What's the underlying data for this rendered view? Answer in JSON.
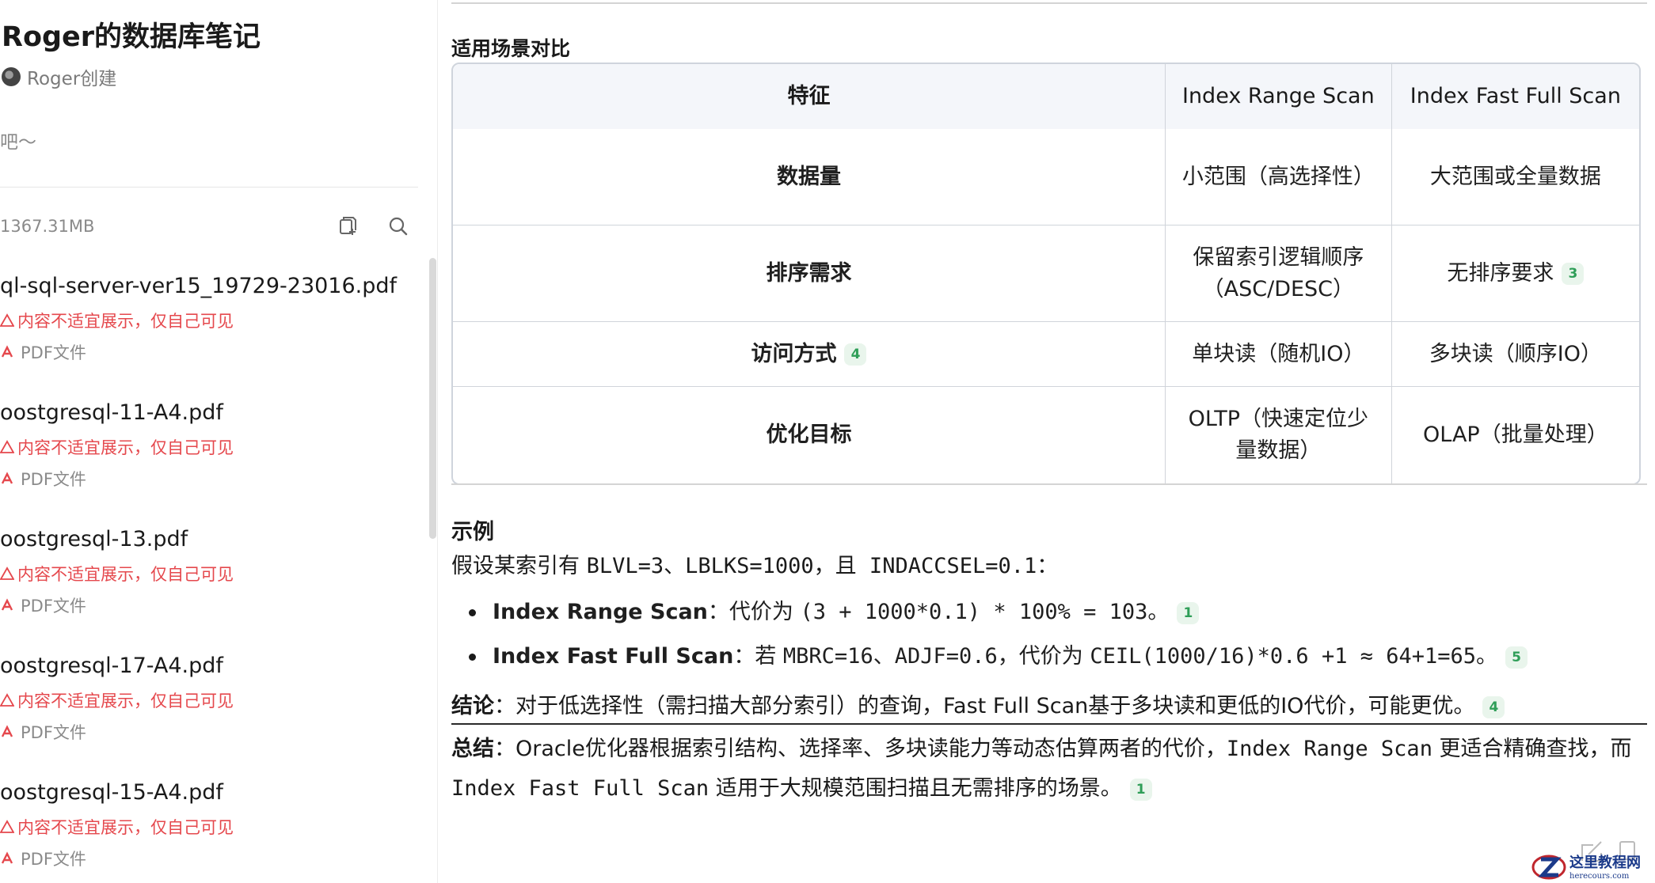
{
  "sidebar": {
    "title": "Roger的数据库笔记",
    "creator": "Roger创建",
    "description": "吧～",
    "storage": "1367.31MB",
    "files": [
      {
        "name": "ql-sql-server-ver15_19729-23016.pdf",
        "warning": "内容不适宜展示，仅自己可见",
        "type": "PDF文件"
      },
      {
        "name": "oostgresql-11-A4.pdf",
        "warning": "内容不适宜展示，仅自己可见",
        "type": "PDF文件"
      },
      {
        "name": "oostgresql-13.pdf",
        "warning": "内容不适宜展示，仅自己可见",
        "type": "PDF文件"
      },
      {
        "name": "oostgresql-17-A4.pdf",
        "warning": "内容不适宜展示，仅自己可见",
        "type": "PDF文件"
      },
      {
        "name": "oostgresql-15-A4.pdf",
        "warning": "内容不适宜展示，仅自己可见",
        "type": "PDF文件"
      }
    ]
  },
  "main": {
    "section_title": "适用场景对比",
    "table": {
      "headers": [
        "特征",
        "Index Range Scan",
        "Index Fast Full Scan"
      ],
      "rows": [
        {
          "feature": "数据量",
          "feature_badge": "",
          "range": "小范围（高选择性）",
          "fast": "大范围或全量数据",
          "fast_badge": ""
        },
        {
          "feature": "排序需求",
          "feature_badge": "",
          "range": "保留索引逻辑顺序（ASC/DESC）",
          "fast": "无排序要求",
          "fast_badge": "3"
        },
        {
          "feature": "访问方式",
          "feature_badge": "4",
          "range": "单块读（随机IO）",
          "fast": "多块读（顺序IO）",
          "fast_badge": ""
        },
        {
          "feature": "优化目标",
          "feature_badge": "",
          "range": "OLTP（快速定位少量数据）",
          "fast": "OLAP（批量处理）",
          "fast_badge": ""
        }
      ]
    },
    "example": {
      "heading": "示例",
      "intro_prefix": "假设某索引有 ",
      "intro_code": "BLVL=3、LBLKS=1000，且 INDACCSEL=0.1",
      "intro_suffix": "：",
      "bullets": [
        {
          "label": "Index Range Scan",
          "sep": "：代价为 ",
          "code": "(3 + 1000*0.1) * 100% = 103",
          "tail": "。",
          "badge": "1"
        },
        {
          "label": "Index Fast Full Scan",
          "sep": "：若 ",
          "code": "MBRC=16、ADJF=0.6",
          "mid": "，代价为 ",
          "code2": "CEIL(1000/16)*0.6 +1 ≈ 64+1=65",
          "tail": "。",
          "badge": "5"
        }
      ]
    },
    "conclusion": {
      "label": "结论",
      "text": "：对于低选择性（需扫描大部分索引）的查询，Fast Full Scan基于多块读和更低的IO代价，可能更优。",
      "badge": "4"
    },
    "summary": {
      "label": "总结",
      "text1": "：Oracle优化器根据索引结构、选择率、多块读能力等动态估算两者的代价，",
      "code1": "Index Range Scan",
      "text2": " 更适合精确查找，而 ",
      "code2": "Index Fast Full Scan",
      "text3": " 适用于大规模范围扫描且无需排序的场景。",
      "badge": "1"
    }
  },
  "watermark": {
    "cn": "这里教程网",
    "en": "herecours.com"
  },
  "colors": {
    "warning": "#e5484d",
    "badge_bg": "#e9f5ec",
    "badge_fg": "#2f9e58",
    "table_header_bg": "#f4f6fa"
  }
}
